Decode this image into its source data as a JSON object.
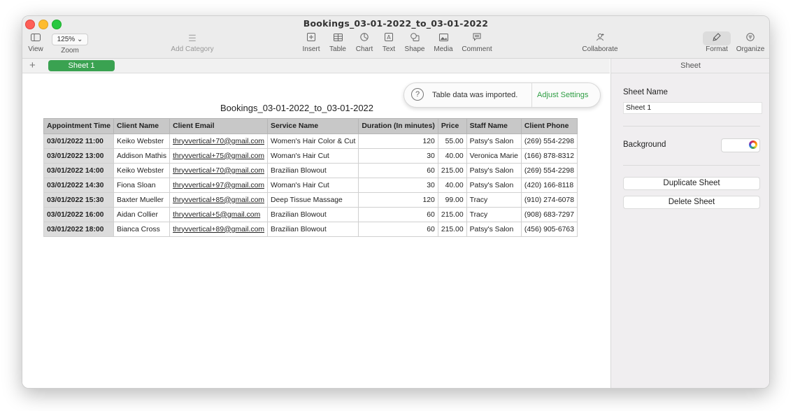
{
  "window": {
    "title": "Bookings_03-01-2022_to_03-01-2022"
  },
  "toolbar": {
    "view_label": "View",
    "zoom_value": "125% ⌄",
    "zoom_label": "Zoom",
    "add_category_label": "Add Category",
    "insert_label": "Insert",
    "table_label": "Table",
    "chart_label": "Chart",
    "text_label": "Text",
    "shape_label": "Shape",
    "media_label": "Media",
    "comment_label": "Comment",
    "collaborate_label": "Collaborate",
    "format_label": "Format",
    "organize_label": "Organize"
  },
  "tabs": {
    "add": "+",
    "sheet1": "Sheet 1"
  },
  "canvas": {
    "doc_title": "Bookings_03-01-2022_to_03-01-2022"
  },
  "notice": {
    "icon": "?",
    "text": "Table data was imported.",
    "action": "Adjust Settings"
  },
  "table": {
    "headers": [
      "Appointment Time",
      "Client Name",
      "Client Email",
      "Service Name",
      "Duration (In minutes)",
      "Price",
      "Staff Name",
      "Client Phone"
    ],
    "rows": [
      [
        "03/01/2022 11:00",
        "Keiko Webster",
        "thryvvertical+70@gmail.com",
        "Women's Hair Color & Cut",
        "120",
        "55.00",
        "Patsy's Salon",
        "(269) 554-2298"
      ],
      [
        "03/01/2022 13:00",
        "Addison Mathis",
        "thryvvertical+75@gmail.com",
        "Woman's Hair Cut",
        "30",
        "40.00",
        "Veronica Marie",
        "(166) 878-8312"
      ],
      [
        "03/01/2022 14:00",
        "Keiko Webster",
        "thryvvertical+70@gmail.com",
        "Brazilian Blowout",
        "60",
        "215.00",
        "Patsy's Salon",
        "(269) 554-2298"
      ],
      [
        "03/01/2022 14:30",
        "Fiona Sloan",
        "thryvvertical+97@gmail.com",
        "Woman's Hair Cut",
        "30",
        "40.00",
        "Patsy's Salon",
        "(420) 166-8118"
      ],
      [
        "03/01/2022 15:30",
        "Baxter Mueller",
        "thryvvertical+85@gmail.com",
        "Deep Tissue Massage",
        "120",
        "99.00",
        "Tracy",
        "(910) 274-6078"
      ],
      [
        "03/01/2022 16:00",
        "Aidan Collier",
        "thryvvertical+5@gmail.com",
        "Brazilian Blowout",
        "60",
        "215.00",
        "Tracy",
        "(908) 683-7297"
      ],
      [
        "03/01/2022 18:00",
        "Bianca Cross",
        "thryvvertical+89@gmail.com",
        "Brazilian Blowout",
        "60",
        "215.00",
        "Patsy's Salon",
        "(456) 905-6763"
      ]
    ]
  },
  "sidebar": {
    "header": "Sheet",
    "sheet_name_label": "Sheet Name",
    "sheet_name_value": "Sheet 1",
    "background_label": "Background",
    "duplicate_label": "Duplicate Sheet",
    "delete_label": "Delete Sheet"
  }
}
